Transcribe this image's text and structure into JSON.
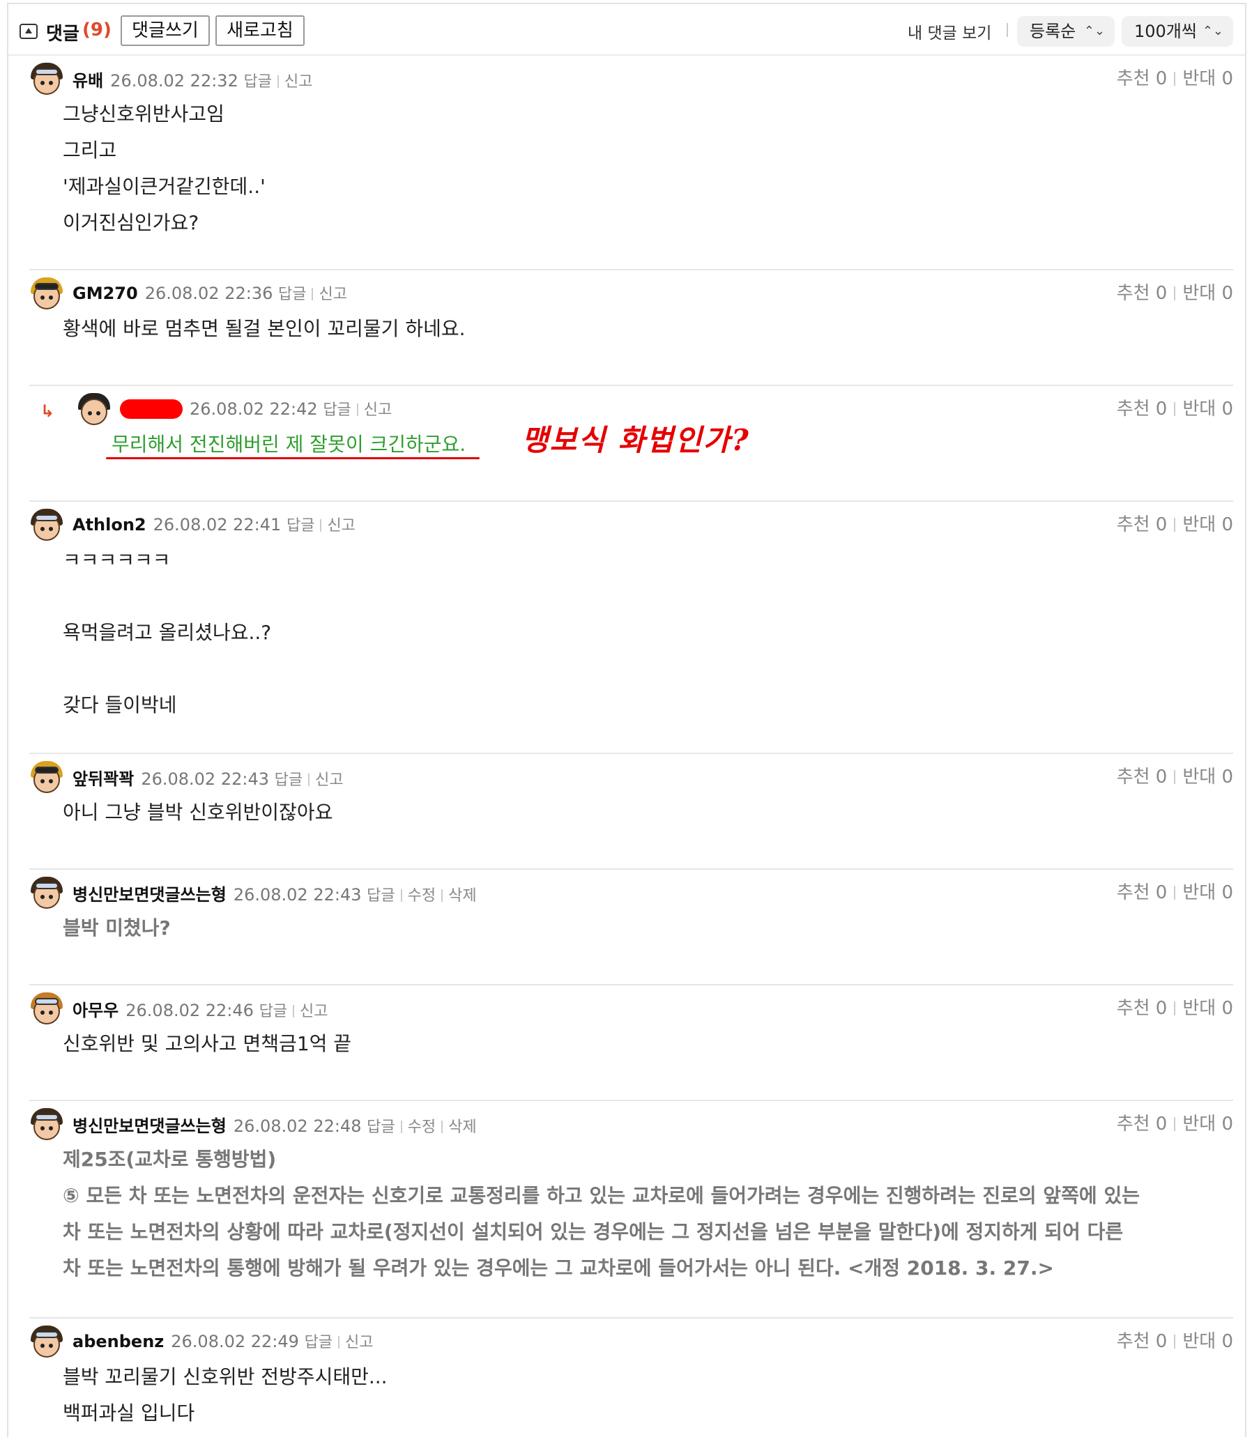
{
  "header": {
    "title": "댓글",
    "count": "(9)",
    "write_label": "댓글쓰기",
    "refresh_label": "새로고침",
    "my_comments_label": "내 댓글 보기",
    "sort_label": "등록순",
    "page_size_label": "100개씩"
  },
  "vote_labels": {
    "up": "추천",
    "down": "반대"
  },
  "comments": [
    {
      "nick": "유배",
      "date": "26.08.02 22:32",
      "actions": [
        "답글",
        "신고"
      ],
      "up": "0",
      "down": "0",
      "lines": [
        "그냥신호위반사고임",
        "그리고",
        "'제과실이큰거같긴한데..'",
        "이거진심인가요?"
      ]
    },
    {
      "nick": "GM270",
      "date": "26.08.02 22:36",
      "actions": [
        "답글",
        "신고"
      ],
      "up": "0",
      "down": "0",
      "lines": [
        "황색에 바로 멈추면 될걸 본인이 꼬리물기 하네요."
      ]
    },
    {
      "nick": "",
      "date": "26.08.02 22:42",
      "actions": [
        "답글",
        "신고"
      ],
      "up": "0",
      "down": "0",
      "lines": [
        "무리해서 전진해버린 제 잘못이 크긴하군요."
      ],
      "annotation": "맹보식 화법인가?"
    },
    {
      "nick": "Athlon2",
      "date": "26.08.02 22:41",
      "actions": [
        "답글",
        "신고"
      ],
      "up": "0",
      "down": "0",
      "lines": [
        "ㅋㅋㅋㅋㅋㅋ",
        "",
        "욕먹을려고 올리셨나요..?",
        "",
        "갖다 들이박네"
      ]
    },
    {
      "nick": "앞뒤꽉꽉",
      "date": "26.08.02 22:43",
      "actions": [
        "답글",
        "신고"
      ],
      "up": "0",
      "down": "0",
      "lines": [
        "아니 그냥 블박 신호위반이잖아요"
      ]
    },
    {
      "nick": "병신만보면댓글쓰는형",
      "date": "26.08.02 22:43",
      "actions": [
        "답글",
        "수정",
        "삭제"
      ],
      "up": "0",
      "down": "0",
      "lines": [
        "블박 미쳤나?"
      ]
    },
    {
      "nick": "아무우",
      "date": "26.08.02 22:46",
      "actions": [
        "답글",
        "신고"
      ],
      "up": "0",
      "down": "0",
      "lines": [
        "신호위반 및 고의사고 면책금1억 끝"
      ]
    },
    {
      "nick": "병신만보면댓글쓰는형",
      "date": "26.08.02 22:48",
      "actions": [
        "답글",
        "수정",
        "삭제"
      ],
      "up": "0",
      "down": "0",
      "lines": [
        "제25조(교차로 통행방법)",
        "⑤ 모든 차 또는 노면전차의 운전자는 신호기로 교통정리를 하고 있는 교차로에 들어가려는 경우에는 진행하려는 진로의 앞쪽에 있는",
        "차 또는 노면전차의 상황에 따라 교차로(정지선이 설치되어 있는 경우에는 그 정지선을 넘은 부분을 말한다)에 정지하게 되어 다른",
        "차 또는 노면전차의 통행에 방해가 될 우려가 있는 경우에는 그 교차로에 들어가서는 아니 된다. <개정 2018. 3. 27.>"
      ]
    },
    {
      "nick": "abenbenz",
      "date": "26.08.02 22:49",
      "actions": [
        "답글",
        "신고"
      ],
      "up": "0",
      "down": "0",
      "lines": [
        "블박 꼬리물기 신호위반 전방주시태만...",
        "백퍼과실 입니다"
      ]
    }
  ]
}
